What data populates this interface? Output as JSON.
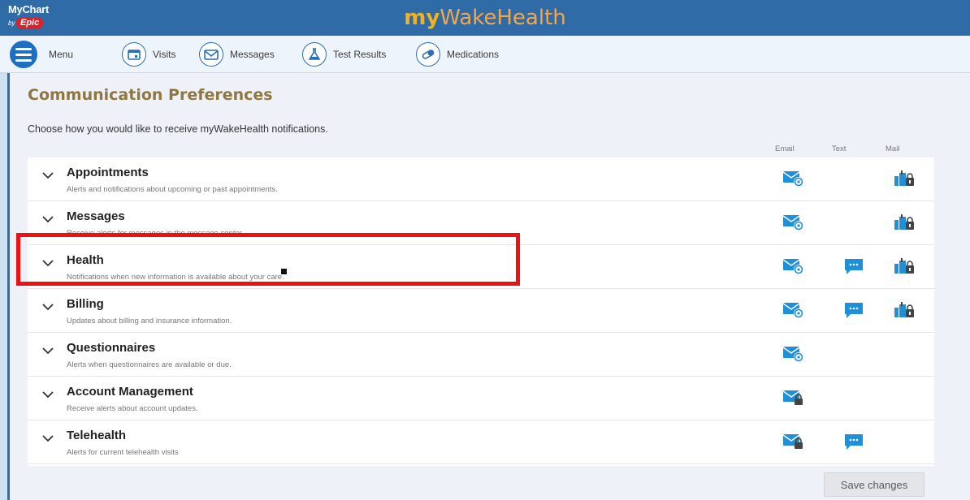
{
  "header": {
    "mychart_logo": "MyChart",
    "by_text": "by",
    "epic_text": "Epic",
    "brand_part1": "my",
    "brand_part2": "WakeHealth"
  },
  "nav": {
    "menu": "Menu",
    "visits": "Visits",
    "messages": "Messages",
    "test_results": "Test Results",
    "medications": "Medications"
  },
  "page": {
    "title": "Communication Preferences",
    "intro": "Choose how you would like to receive myWakeHealth notifications.",
    "columns": {
      "email": "Email",
      "text": "Text",
      "mail": "Mail"
    }
  },
  "rows": [
    {
      "title": "Appointments",
      "desc": "Alerts and notifications about upcoming or past appointments.",
      "email": "email-at",
      "text": "",
      "mail": "mail-lock"
    },
    {
      "title": "Messages",
      "desc": "Receive alerts for messages in the message center.",
      "email": "email-at",
      "text": "",
      "mail": "mail-lock"
    },
    {
      "title": "Health",
      "desc": "Notifications when new information is available about your care.",
      "email": "email-at",
      "text": "text-bubble",
      "mail": "mail-lock"
    },
    {
      "title": "Billing",
      "desc": "Updates about billing and insurance information.",
      "email": "email-at",
      "text": "text-bubble",
      "mail": "mail-lock"
    },
    {
      "title": "Questionnaires",
      "desc": "Alerts when questionnaires are available or due.",
      "email": "email-at",
      "text": "",
      "mail": ""
    },
    {
      "title": "Account Management",
      "desc": "Receive alerts about account updates.",
      "email": "email-lock",
      "text": "",
      "mail": ""
    },
    {
      "title": "Telehealth",
      "desc": "Alerts for current telehealth visits",
      "email": "email-lock",
      "text": "text-bubble",
      "mail": ""
    }
  ],
  "actions": {
    "save": "Save changes"
  },
  "colors": {
    "header_bg": "#2f6ba6",
    "icon_blue": "#1e8fd8",
    "highlight": "#ee1111",
    "title_gold": "#8f7740"
  }
}
